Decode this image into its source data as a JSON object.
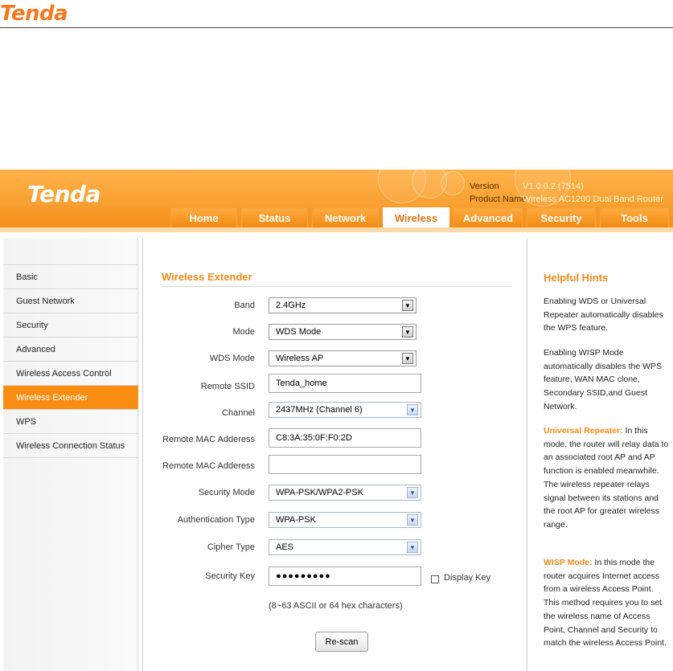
{
  "document": {
    "logo": "Tenda"
  },
  "header": {
    "logo": "Tenda",
    "version_label": "Version",
    "version_value": "V1.0.0.2 (7514)",
    "product_label": "Product Name",
    "product_value": "Wireless AC1200 Dual Band Router"
  },
  "nav": {
    "tabs": [
      "Home",
      "Status",
      "Network",
      "Wireless",
      "Advanced",
      "Security",
      "Tools"
    ],
    "active": "Wireless"
  },
  "sidebar": {
    "items": [
      "Basic",
      "Guest Network",
      "Security",
      "Advanced",
      "Wireless Access Control",
      "Wireless Extender",
      "WPS",
      "Wireless Connection Status"
    ],
    "active": "Wireless Extender"
  },
  "form": {
    "title": "Wireless Extender",
    "band": {
      "label": "Band",
      "value": "2.4GHz"
    },
    "mode": {
      "label": "Mode",
      "value": "WDS Mode"
    },
    "wds_mode": {
      "label": "WDS Mode",
      "value": "Wireless AP"
    },
    "remote_ssid": {
      "label": "Remote SSID",
      "value": "Tenda_home"
    },
    "channel": {
      "label": "Channel",
      "value": "2437MHz (Channel 6)"
    },
    "remote_mac_1": {
      "label": "Remote MAC Adderess",
      "value": "C8:3A:35:0F:F0:2D"
    },
    "remote_mac_2": {
      "label": "Remote MAC Adderess",
      "value": ""
    },
    "security_mode": {
      "label": "Security Mode",
      "value": "WPA-PSK/WPA2-PSK"
    },
    "auth_type": {
      "label": "Authentication Type",
      "value": "WPA-PSK"
    },
    "cipher_type": {
      "label": "Cipher Type",
      "value": "AES"
    },
    "security_key": {
      "label": "Security Key",
      "value": "●●●●●●●●●"
    },
    "display_key_label": "Display Key",
    "key_hint": "(8~63 ASCII or 64 hex characters)",
    "rescan_label": "Re-scan"
  },
  "hints": {
    "title": "Helpful Hints",
    "p1": "Enabling WDS or Universal Repeater automatically disables the WPS feature.",
    "p2": "Enabling WISP Mode automatically disables the WPS feature, WAN MAC clone, Secondary SSID,and Guest Network.",
    "p3_title": "Universal Repeater:",
    "p3": " In this mode, the router will relay data to an associated root AP and AP function is enabled meanwhile. The wireless repeater relays signal between its stations and the root AP for greater wireless range.",
    "p4_title": "WISP Mode:",
    "p4": " In this mode the router acquires Internet access from a wireless Access Point. This method requires you to set the wireless name of Access Point, Channel and Security to match the wireless Access Point."
  },
  "colors": {
    "accent": "#f48a18",
    "active_tab": "#ffffff",
    "sidebar_active": "#f98d12"
  }
}
